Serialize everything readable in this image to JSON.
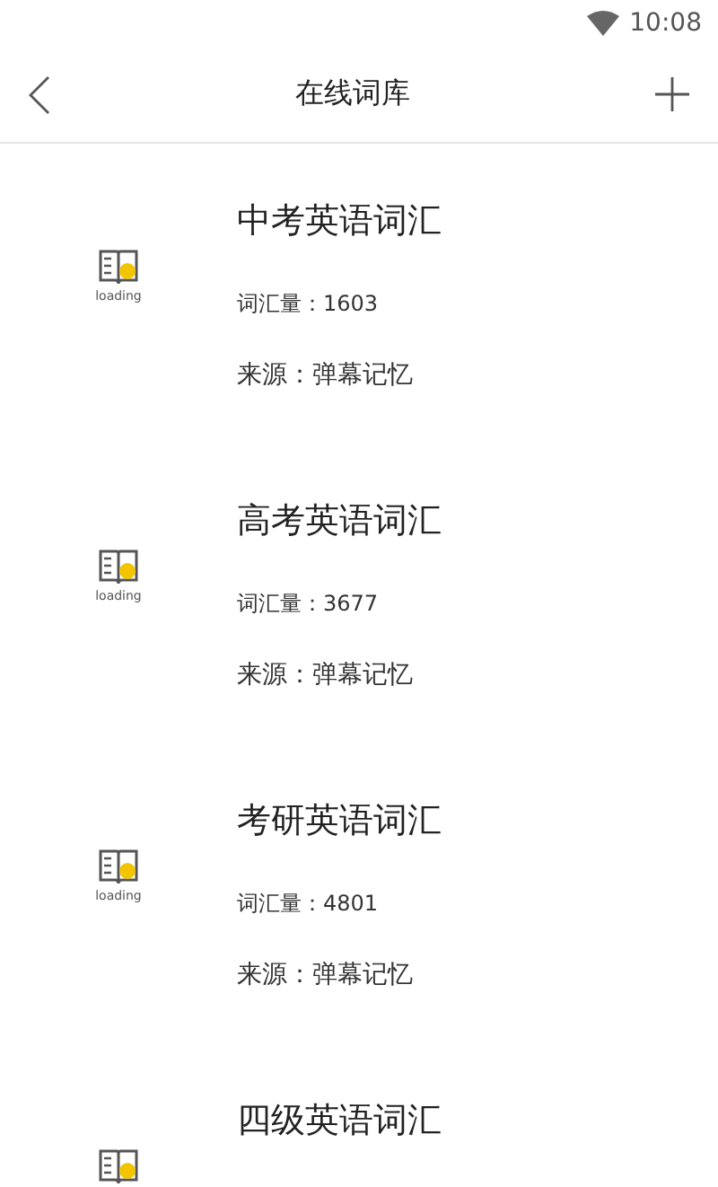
{
  "status_bar": {
    "time": "10:08"
  },
  "header": {
    "title": "在线词库"
  },
  "items": [
    {
      "title": "中考英语词汇",
      "icon_label": "loading",
      "count": "词汇量：1603",
      "source": "来源：弹幕记忆"
    },
    {
      "title": "高考英语词汇",
      "icon_label": "loading",
      "count": "词汇量：3677",
      "source": "来源：弹幕记忆"
    },
    {
      "title": "考研英语词汇",
      "icon_label": "loading",
      "count": "词汇量：4801",
      "source": "来源：弹幕记忆"
    },
    {
      "title": "四级英语词汇"
    }
  ]
}
